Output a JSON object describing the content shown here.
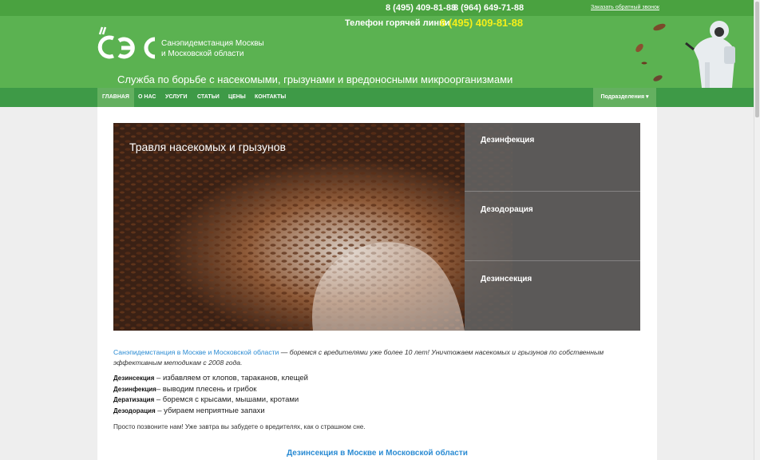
{
  "header": {
    "phone_top_1": "8 (495) 409-81-88",
    "phone_top_2": "8 (964) 649-71-88",
    "callback_link": "Заказать обратный звонок",
    "logo_text_line1": "Санэпидемстанция Москвы",
    "logo_text_line2": "и Московской области",
    "hotline_label": "Телефон горячей линии",
    "hotline_number": "8 (495) 409-81-88",
    "tagline": "Служба по борьбе с насекомыми, грызунами и вредоносными микроорганизмами"
  },
  "nav": {
    "items": [
      {
        "label": "Главная"
      },
      {
        "label": "О нас"
      },
      {
        "label": "Услуги"
      },
      {
        "label": "Статьи"
      },
      {
        "label": "Цены"
      },
      {
        "label": "Контакты"
      }
    ],
    "right_label": "Подразделения ▾"
  },
  "slider": {
    "title": "Травля насекомых и грызунов",
    "items": [
      {
        "label": "Дезинфекция"
      },
      {
        "label": "Дезодорация"
      },
      {
        "label": "Дезинсекция"
      }
    ]
  },
  "main": {
    "intro_link": "Санэпидемстанция в Москве и Московской области",
    "intro_text": " — боремся с вредителями уже более 10 лет! Уничтожаем насекомых и грызунов по собственным эффективным методикам с 2008 года.",
    "services": [
      {
        "term": "Дезинсекция",
        "desc": " – избавляем от клопов, тараканов, клещей"
      },
      {
        "term": "Дезинфекция",
        "desc": "– выводим плесень и грибок"
      },
      {
        "term": "Дератизация",
        "desc": " – боремся с крысами, мышами, кротами"
      },
      {
        "term": "Дезодорация",
        "desc": " – убираем неприятные запахи"
      }
    ],
    "call_text": "Просто позвоните нам! Уже завтра вы забудете о вредителях, как о страшном сне.",
    "section_title": "Дезинсекция в Москве и Московской области"
  },
  "colors": {
    "header_green": "#5bb251",
    "nav_green": "#3e9a47",
    "hotline_yellow": "#f3ef1a",
    "link_blue": "#2a8bd3"
  }
}
